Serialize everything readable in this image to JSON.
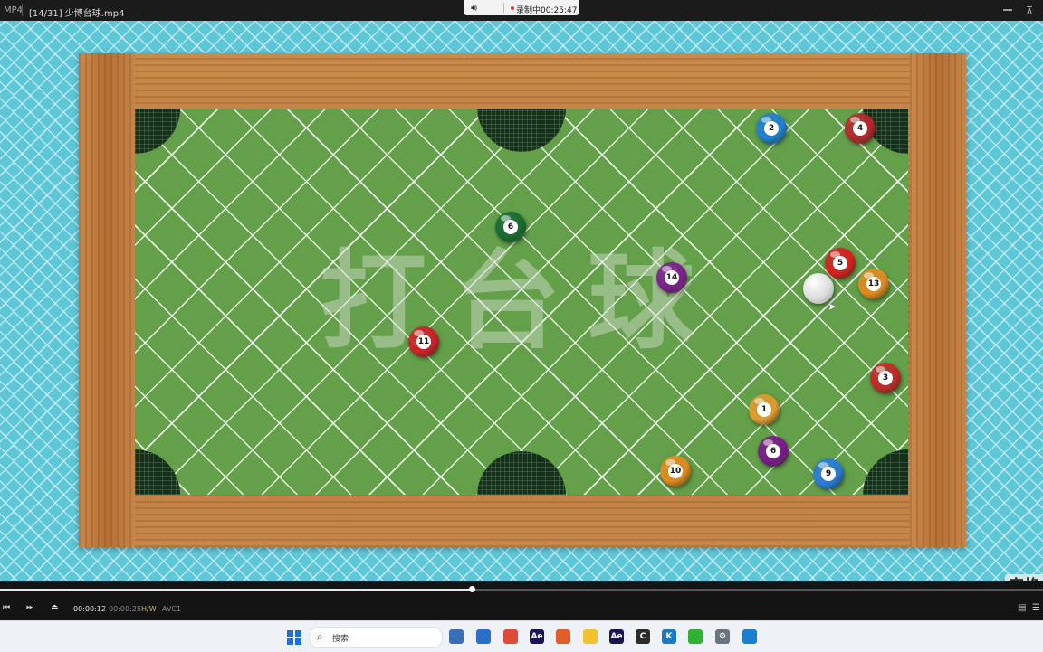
{
  "titlebar": {
    "format": "MP4",
    "file_name": "[14/31] 少博台球.mp4",
    "recording": "录制中00:25:47",
    "pin_glyph": "⊼"
  },
  "video": {
    "watermark_text": "打台球",
    "keyboard_overlay": "空格",
    "balls": [
      {
        "num": "2",
        "color": "#1f7fd1"
      },
      {
        "num": "4",
        "color": "#b3282d"
      },
      {
        "num": "6",
        "color": "#1a6b33"
      },
      {
        "num": "14",
        "color": "#7a1f8c"
      },
      {
        "num": "5",
        "color": "#d42020"
      },
      {
        "num": "13",
        "color": "#e08a20"
      },
      {
        "num": "11",
        "color": "#cc2028"
      },
      {
        "num": "3",
        "color": "#c02a2a"
      },
      {
        "num": "1",
        "color": "#e09a30"
      },
      {
        "num": "6",
        "color": "#7a1a8a"
      },
      {
        "num": "9",
        "color": "#2a7ad5"
      },
      {
        "num": "10",
        "color": "#e08a20"
      }
    ]
  },
  "player": {
    "current_time": "00:00:12",
    "separator": "/",
    "duration": "00:00:25",
    "hw_label": "H/W",
    "codec": "AVC1",
    "progress_fraction": 0.452
  },
  "taskbar": {
    "search_placeholder": "搜索",
    "apps": [
      {
        "name": "file-app-icon",
        "label": "",
        "color": "#3a6fb5"
      },
      {
        "name": "mail-icon",
        "label": "",
        "color": "#2a6fc9"
      },
      {
        "name": "chrome-icon",
        "label": "",
        "color": "#dd4b39"
      },
      {
        "name": "after-effects-icon",
        "label": "Ae",
        "color": "#1a1452"
      },
      {
        "name": "app-icon",
        "label": "",
        "color": "#e35c2a"
      },
      {
        "name": "folder-icon",
        "label": "",
        "color": "#f2c12e"
      },
      {
        "name": "after-effects-icon-2",
        "label": "Ae",
        "color": "#1a1452"
      },
      {
        "name": "circle-app-icon",
        "label": "C",
        "color": "#2b2b2b"
      },
      {
        "name": "k-app-icon",
        "label": "K",
        "color": "#1c7ac2"
      },
      {
        "name": "wechat-icon",
        "label": "",
        "color": "#2eb135"
      },
      {
        "name": "settings-icon",
        "label": "⚙",
        "color": "#6b7580"
      },
      {
        "name": "vscode-icon",
        "label": "",
        "color": "#1b7fcf"
      }
    ]
  }
}
